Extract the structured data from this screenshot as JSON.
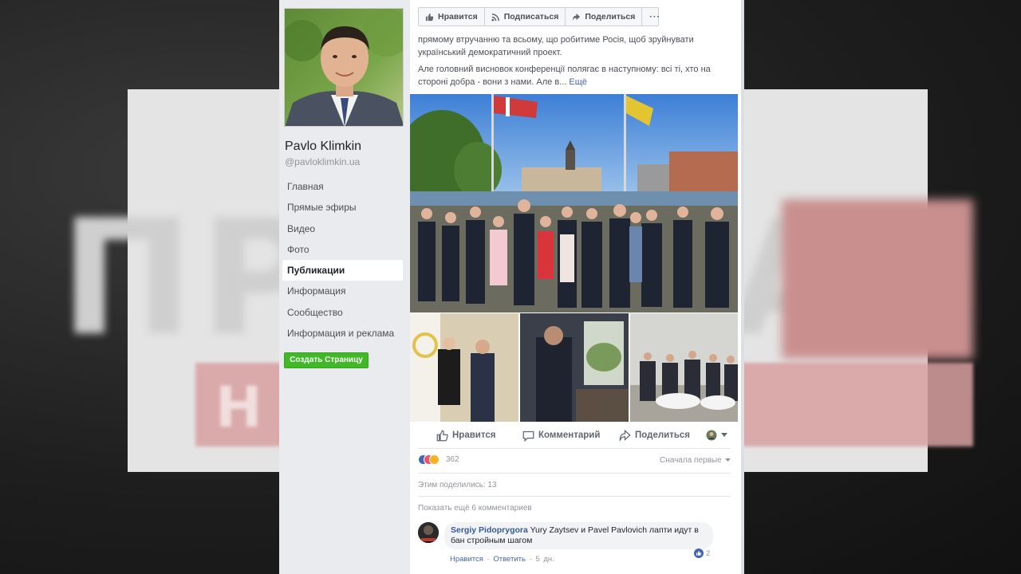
{
  "background": {
    "word": "ПРАВДА",
    "strip_text": "НА"
  },
  "page": {
    "name": "Pavlo Klimkin",
    "handle": "@pavloklimkin.ua"
  },
  "nav": {
    "items": [
      {
        "label": "Главная"
      },
      {
        "label": "Прямые эфиры"
      },
      {
        "label": "Видео"
      },
      {
        "label": "Фото"
      },
      {
        "label": "Публикации"
      },
      {
        "label": "Информация"
      },
      {
        "label": "Сообщество"
      },
      {
        "label": "Информация и реклама"
      }
    ],
    "active": "Публикации"
  },
  "create_page_button": "Создать Страницу",
  "top_actions": {
    "like": "Нравится",
    "follow": "Подписаться",
    "share": "Поделиться",
    "more": "···"
  },
  "post": {
    "text_line1": "прямому втручанню та всьому, що робитиме Росія, щоб зруйнувати",
    "text_line2": "український демократичний проект.",
    "text_line3": "Але головний висновок конференції полягає в наступному: всі ті, хто на",
    "text_line4": "стороні добра - вони з нами. Але в...",
    "more": "Ещё"
  },
  "post_actions": {
    "like": "Нравится",
    "comment": "Комментарий",
    "share": "Поделиться"
  },
  "stats": {
    "reactions_count": "362",
    "sort": "Сначала первые",
    "shares": "Этим поделились: 13",
    "previous_comments": "Показать ещё 6 комментариев"
  },
  "comment": {
    "author": "Sergiy Pidoprygora",
    "text": "Yury Zaytsev и Pavel Pavlovich лапти идут в бан стройным шагом",
    "likes": "2",
    "like_label": "Нравится",
    "reply_label": "Ответить",
    "time": "5 дн."
  },
  "colors": {
    "facebook_blue": "#4267b2",
    "button_green": "#42b72a",
    "sidebar_bg": "#e9ebee"
  }
}
